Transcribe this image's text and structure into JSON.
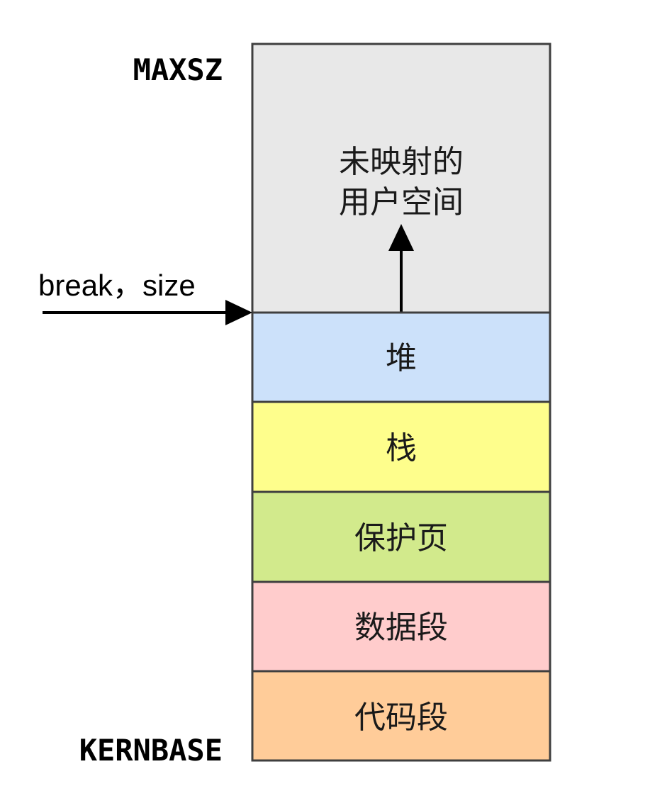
{
  "labels": {
    "top_address": "MAXSZ",
    "bottom_address": "KERNBASE",
    "pointer": "break，size"
  },
  "unmapped": {
    "line1": "未映射的",
    "line2": "用户空间",
    "color": "#e8e8e8"
  },
  "segments": [
    {
      "label": "堆",
      "color": "#cce1fa"
    },
    {
      "label": "栈",
      "color": "#fefe8c"
    },
    {
      "label": "保护页",
      "color": "#d2ea8c"
    },
    {
      "label": "数据段",
      "color": "#ffcccc"
    },
    {
      "label": "代码段",
      "color": "#ffcc99"
    }
  ],
  "colors": {
    "border": "#3f3f3f",
    "arrow": "#000000"
  }
}
